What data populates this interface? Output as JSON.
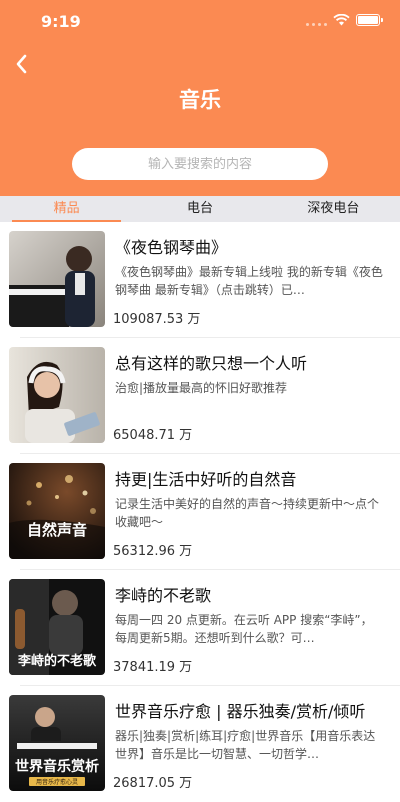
{
  "status_bar": {
    "time": "9:19"
  },
  "header": {
    "title": "音乐",
    "back_icon": "chevron-left-icon"
  },
  "search": {
    "placeholder": "输入要搜索的内容"
  },
  "tabs": [
    {
      "label": "精品",
      "active": true
    },
    {
      "label": "电台",
      "active": false
    },
    {
      "label": "深夜电台",
      "active": false
    }
  ],
  "albums": [
    {
      "title": "《夜色钢琴曲》",
      "description": "《夜色钢琴曲》最新专辑上线啦 我的新专辑《夜色钢琴曲 最新专辑》（点击跳转）已…",
      "plays": "109087.53 万"
    },
    {
      "title": "总有这样的歌只想一个人听",
      "description": "治愈|播放量最高的怀旧好歌推荐",
      "plays": "65048.71 万"
    },
    {
      "title": "持更|生活中好听的自然音",
      "description": "记录生活中美好的自然的声音～持续更新中～点个收藏吧～",
      "plays": "56312.96 万",
      "cover_text": "自然声音"
    },
    {
      "title": "李峙的不老歌",
      "description": "每周一四 20 点更新。在云听 APP 搜索“李峙”，每周更新5期。还想听到什么歌？可…",
      "plays": "37841.19 万",
      "cover_text": "李峙的不老歌"
    },
    {
      "title": "世界音乐疗愈 | 器乐独奏/赏析/倾听",
      "description": "器乐|独奏|赏析|练耳|疗愈|世界音乐【用音乐表达世界】音乐是比一切智慧、一切哲学…",
      "plays": "26817.05 万",
      "cover_text": "世界音乐赏析",
      "cover_subtext": "用音乐疗愈心灵"
    }
  ],
  "colors": {
    "accent": "#fb8a52",
    "tab_bar": "#e8e8ec"
  }
}
